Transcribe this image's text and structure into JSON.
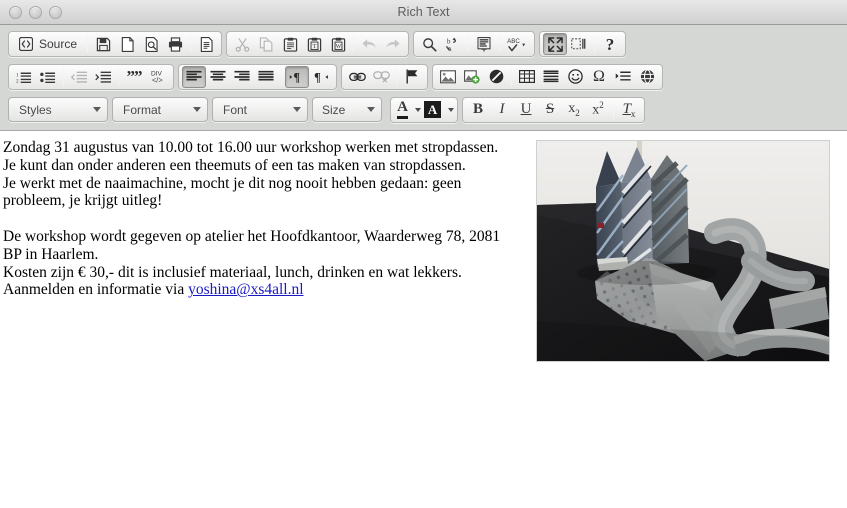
{
  "window": {
    "title": "Rich Text",
    "controls": [
      "close",
      "minimize",
      "zoom"
    ]
  },
  "toolbar": {
    "row1": {
      "group_document": {
        "source_label": "Source",
        "buttons": [
          {
            "name": "source",
            "icon": "source-icon",
            "label": "Source",
            "state": "normal"
          },
          {
            "name": "save",
            "icon": "save-icon",
            "label": "Save",
            "state": "normal"
          },
          {
            "name": "new-page",
            "icon": "new-page-icon",
            "label": "New Page",
            "state": "normal"
          },
          {
            "name": "preview",
            "icon": "preview-icon",
            "label": "Preview",
            "state": "normal"
          },
          {
            "name": "print",
            "icon": "print-icon",
            "label": "Print",
            "state": "normal"
          },
          {
            "name": "templates",
            "icon": "templates-icon",
            "label": "Templates",
            "state": "normal"
          }
        ]
      },
      "group_clipboard": [
        {
          "name": "cut",
          "icon": "scissors-icon",
          "label": "Cut",
          "state": "disabled"
        },
        {
          "name": "copy",
          "icon": "copy-icon",
          "label": "Copy",
          "state": "disabled"
        },
        {
          "name": "paste",
          "icon": "paste-icon",
          "label": "Paste",
          "state": "normal"
        },
        {
          "name": "paste-text",
          "icon": "paste-text-icon",
          "label": "Paste as plain text",
          "state": "normal"
        },
        {
          "name": "paste-word",
          "icon": "paste-word-icon",
          "label": "Paste from Word",
          "state": "normal"
        },
        {
          "name": "undo",
          "icon": "undo-arrow-icon",
          "label": "Undo",
          "state": "disabled"
        },
        {
          "name": "redo",
          "icon": "redo-arrow-icon",
          "label": "Redo",
          "state": "disabled"
        }
      ],
      "group_tools": [
        {
          "name": "find",
          "icon": "magnifier-icon",
          "label": "Find",
          "state": "normal"
        },
        {
          "name": "replace",
          "icon": "replace-icon",
          "label": "Replace",
          "state": "normal"
        },
        {
          "name": "select-all",
          "icon": "select-all-icon",
          "label": "Select All",
          "state": "normal"
        },
        {
          "name": "spellcheck",
          "icon": "spellcheck-abc-icon",
          "label": "Spell Check As You Type",
          "state": "normal"
        }
      ],
      "group_view": [
        {
          "name": "maximize",
          "icon": "maximize-icon",
          "label": "Maximize",
          "state": "active"
        },
        {
          "name": "show-blocks",
          "icon": "show-blocks-icon",
          "label": "Show Blocks",
          "state": "normal"
        },
        {
          "name": "about",
          "icon": "question-mark-icon",
          "label": "About",
          "state": "normal"
        }
      ]
    },
    "row2": {
      "group_lists": [
        {
          "name": "numbered-list",
          "icon": "numbered-list-icon",
          "label": "Insert/Remove Numbered List",
          "state": "normal"
        },
        {
          "name": "bulleted-list",
          "icon": "bulleted-list-icon",
          "label": "Insert/Remove Bulleted List",
          "state": "normal"
        },
        {
          "name": "outdent",
          "icon": "outdent-icon",
          "label": "Decrease Indent",
          "state": "disabled"
        },
        {
          "name": "indent",
          "icon": "indent-icon",
          "label": "Increase Indent",
          "state": "normal"
        },
        {
          "name": "blockquote",
          "icon": "quote-icon",
          "label": "Block Quote",
          "state": "normal"
        },
        {
          "name": "create-div",
          "icon": "div-container-icon",
          "label": "Create Div Container",
          "state": "normal"
        }
      ],
      "group_align": [
        {
          "name": "align-left",
          "icon": "align-left-icon",
          "label": "Align Left",
          "state": "active"
        },
        {
          "name": "align-center",
          "icon": "align-center-icon",
          "label": "Center",
          "state": "normal"
        },
        {
          "name": "align-right",
          "icon": "align-right-icon",
          "label": "Align Right",
          "state": "normal"
        },
        {
          "name": "justify",
          "icon": "justify-icon",
          "label": "Justify",
          "state": "normal"
        },
        {
          "name": "ltr",
          "icon": "text-direction-ltr-icon",
          "label": "Text direction from left to right",
          "state": "active"
        },
        {
          "name": "rtl",
          "icon": "text-direction-rtl-icon",
          "label": "Text direction from right to left",
          "state": "normal"
        }
      ],
      "group_links": [
        {
          "name": "link",
          "icon": "link-icon",
          "label": "Link",
          "state": "normal"
        },
        {
          "name": "unlink",
          "icon": "unlink-icon",
          "label": "Unlink",
          "state": "disabled"
        },
        {
          "name": "anchor",
          "icon": "flag-anchor-icon",
          "label": "Anchor",
          "state": "normal"
        }
      ],
      "group_insert": [
        {
          "name": "image",
          "icon": "image-icon",
          "label": "Image",
          "state": "normal"
        },
        {
          "name": "flash",
          "icon": "flash-icon",
          "label": "Flash",
          "state": "normal"
        },
        {
          "name": "pagebreak-circle",
          "icon": "no-entry-icon",
          "label": "Page Break",
          "state": "normal"
        },
        {
          "name": "table",
          "icon": "table-grid-icon",
          "label": "Table",
          "state": "normal"
        },
        {
          "name": "horizontal-rule",
          "icon": "horizontal-rule-icon",
          "label": "Horizontal Line",
          "state": "normal"
        },
        {
          "name": "smiley",
          "icon": "smiley-face-icon",
          "label": "Smiley",
          "state": "normal"
        },
        {
          "name": "special-char",
          "icon": "omega-icon",
          "label": "Insert Special Character",
          "state": "normal"
        },
        {
          "name": "page-break",
          "icon": "page-break-icon",
          "label": "Insert Page Break for Printing",
          "state": "normal"
        },
        {
          "name": "iframe",
          "icon": "globe-iframe-icon",
          "label": "IFrame",
          "state": "normal"
        }
      ]
    },
    "row3": {
      "combos": [
        {
          "name": "styles",
          "label": "Styles"
        },
        {
          "name": "format",
          "label": "Format"
        },
        {
          "name": "font",
          "label": "Font"
        },
        {
          "name": "size",
          "label": "Size"
        }
      ],
      "group_colors": [
        {
          "name": "text-color",
          "icon": "text-color-icon",
          "label": "Text Color",
          "state": "normal"
        },
        {
          "name": "bg-color",
          "icon": "background-color-icon",
          "label": "Background Color",
          "state": "normal"
        }
      ],
      "group_basic": [
        {
          "name": "bold",
          "icon": "bold-icon",
          "label": "B",
          "state": "normal"
        },
        {
          "name": "italic",
          "icon": "italic-icon",
          "label": "I",
          "state": "normal"
        },
        {
          "name": "underline",
          "icon": "underline-icon",
          "label": "U",
          "state": "normal"
        },
        {
          "name": "strike",
          "icon": "strikethrough-icon",
          "label": "S",
          "state": "normal"
        },
        {
          "name": "subscript",
          "icon": "subscript-icon",
          "label": "x",
          "state": "normal"
        },
        {
          "name": "superscript",
          "icon": "superscript-icon",
          "label": "x",
          "state": "normal"
        },
        {
          "name": "remove-format",
          "icon": "remove-format-icon",
          "label": "Tx",
          "state": "normal"
        }
      ]
    }
  },
  "document": {
    "paragraph1_line1": "Zondag 31 augustus van 10.00 tot 16.00 uur workshop werken met stropdassen.",
    "paragraph1_line2": "Je kunt dan onder anderen een theemuts of een tas maken van stropdassen.",
    "paragraph1_line3": "Je werkt met de naaimachine, mocht je dit nog nooit hebben gedaan: geen",
    "paragraph1_line4": "probleem, je krijgt uitleg!",
    "paragraph2_line1": "De workshop wordt gegeven op atelier het Hoofdkantoor, Waarderweg 78, 2081",
    "paragraph2_line2": "BP in Haarlem.",
    "paragraph2_line3": "Kosten zijn € 30,- dit is inclusief materiaal, lunch, drinken en wat lekkers.",
    "paragraph2_line4_prefix": "Aanmelden en informatie via ",
    "paragraph2_email": "yoshina@xs4all.nl",
    "image": {
      "name": "neckties-photo",
      "alt": "Photo of a handbag made from striped neckties on a dark table with loose grey ties"
    }
  },
  "colors": {
    "toolbar_bg": "#d5d7d4",
    "titlebar_top": "#e8e8e8",
    "titlebar_bottom": "#d0d0d0",
    "link": "#1919c4",
    "text": "#000000",
    "title_text": "#5d5d5d"
  }
}
